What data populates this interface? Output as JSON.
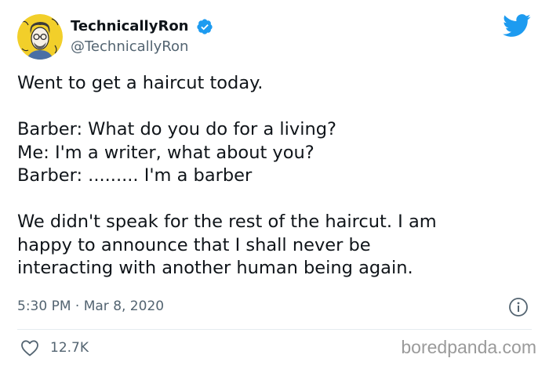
{
  "author": {
    "display_name": "TechnicallyRon",
    "handle": "@TechnicallyRon",
    "verified": true,
    "avatar_icon": "cartoon-portrait-avatar"
  },
  "tweet": {
    "lines": [
      "Went to get a haircut today.",
      "Barber: What do you do for a living?",
      "Me: I'm a writer, what about you?",
      "Barber: ......... I'm a barber",
      "We didn't speak for the rest of the haircut. I am",
      "happy to announce that I shall never be",
      "interacting with another human being again."
    ],
    "timestamp": "5:30 PM · Mar 8, 2020",
    "likes": "12.7K"
  },
  "icons": {
    "platform_logo": "twitter-bird-icon",
    "verified": "verified-badge-icon",
    "info": "info-icon",
    "like": "heart-icon"
  },
  "watermark": "boredpanda.com",
  "colors": {
    "brand": "#1d9bf0",
    "text": "#0f1419",
    "secondary_text": "#536471",
    "divider": "#e6ecf0",
    "watermark": "#9a9a9a"
  }
}
